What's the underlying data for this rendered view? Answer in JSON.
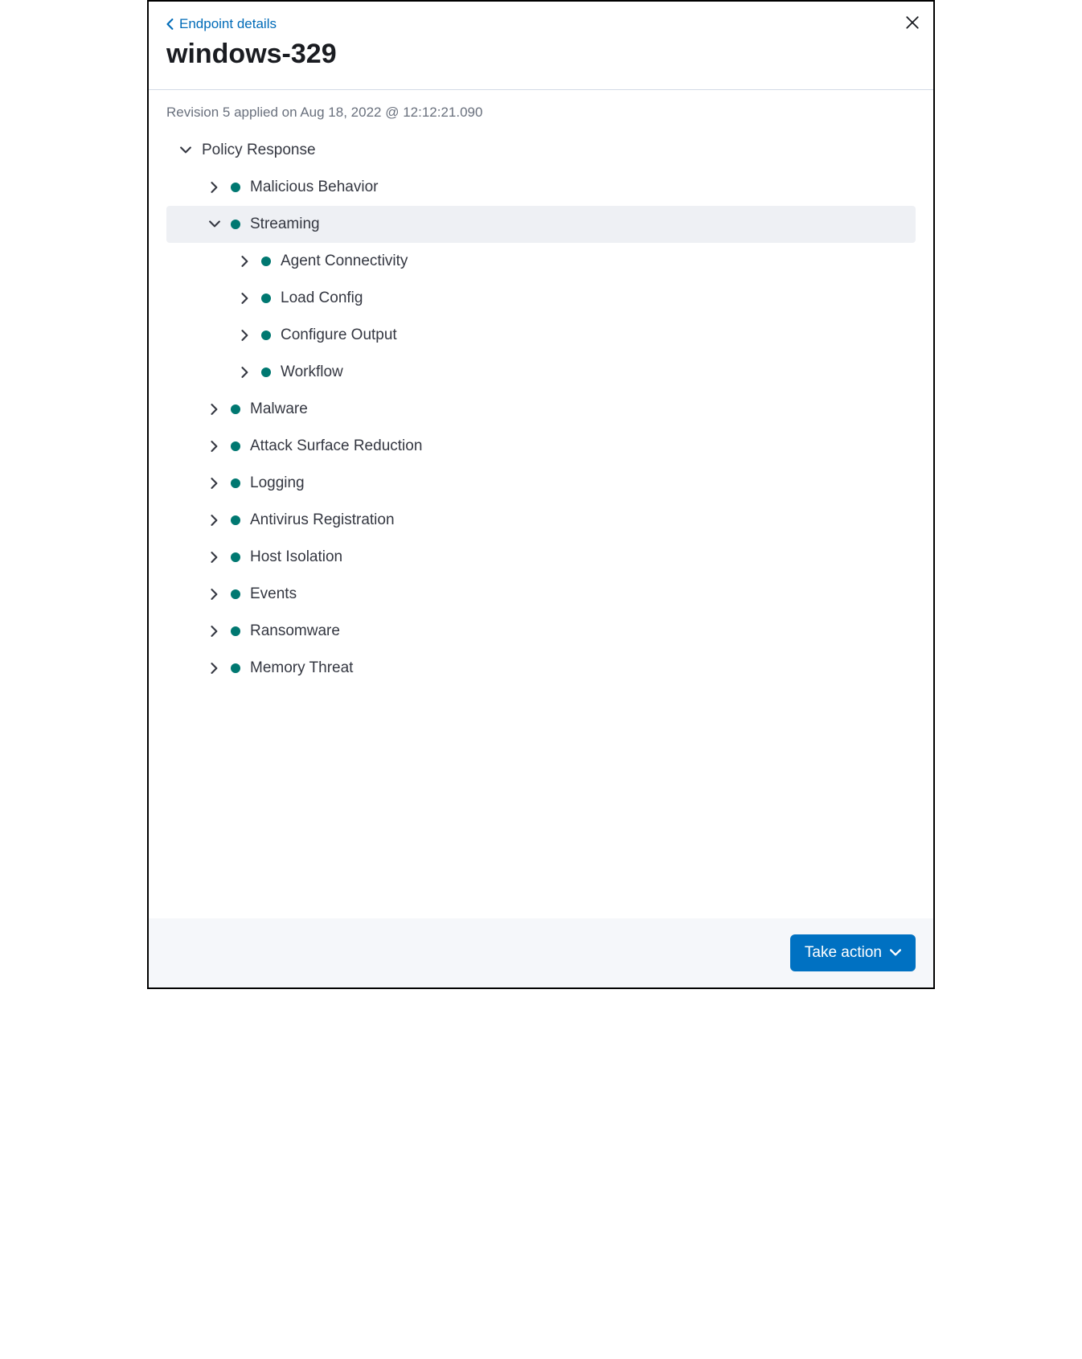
{
  "colors": {
    "accent": "#0071c2",
    "link": "#006bb8",
    "status_dot": "#007871"
  },
  "header": {
    "back_label": "Endpoint details",
    "title": "windows-329"
  },
  "body": {
    "revision_text": "Revision 5 applied on Aug 18, 2022 @ 12:12:21.090",
    "tree_root_label": "Policy Response",
    "items": {
      "malicious_behavior": "Malicious Behavior",
      "streaming": "Streaming",
      "streaming_children": {
        "agent_connectivity": "Agent Connectivity",
        "load_config": "Load Config",
        "configure_output": "Configure Output",
        "workflow": "Workflow"
      },
      "malware": "Malware",
      "attack_surface_reduction": "Attack Surface Reduction",
      "logging": "Logging",
      "antivirus_registration": "Antivirus Registration",
      "host_isolation": "Host Isolation",
      "events": "Events",
      "ransomware": "Ransomware",
      "memory_threat": "Memory Threat"
    }
  },
  "footer": {
    "take_action_label": "Take action"
  }
}
